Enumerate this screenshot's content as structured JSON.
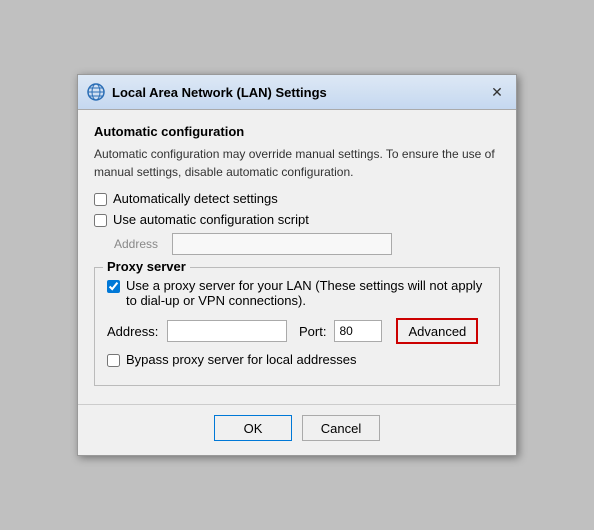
{
  "dialog": {
    "title": "Local Area Network (LAN) Settings",
    "close_button_label": "✕"
  },
  "automatic_config": {
    "section_label": "Automatic configuration",
    "description": "Automatic configuration may override manual settings. To ensure the use of manual settings, disable automatic configuration.",
    "auto_detect_label": "Automatically detect settings",
    "auto_detect_checked": false,
    "use_script_label": "Use automatic configuration script",
    "use_script_checked": false,
    "address_label": "Address",
    "address_placeholder": ""
  },
  "proxy_server": {
    "section_label": "Proxy server",
    "use_proxy_label": "Use a proxy server for your LAN (These settings will not apply to dial-up or VPN connections).",
    "use_proxy_checked": true,
    "address_label": "Address:",
    "address_value": "",
    "port_label": "Port:",
    "port_value": "80",
    "advanced_label": "Advanced",
    "bypass_label": "Bypass proxy server for local addresses",
    "bypass_checked": false
  },
  "footer": {
    "ok_label": "OK",
    "cancel_label": "Cancel"
  }
}
